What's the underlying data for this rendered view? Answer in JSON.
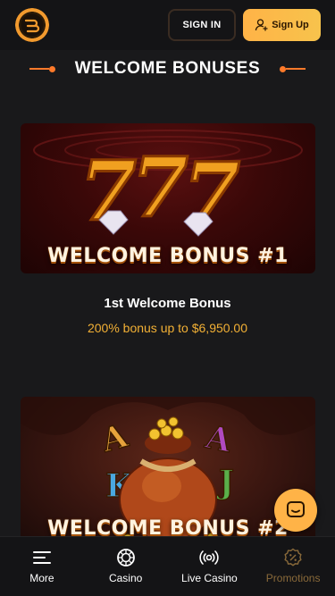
{
  "header": {
    "signin_label": "SIGN IN",
    "signup_label": "Sign Up"
  },
  "section": {
    "title": "WELCOME BONUSES"
  },
  "bonuses": [
    {
      "banner_text": "WELCOME BONUS #1",
      "title": "1st Welcome Bonus",
      "offer": "200% bonus up to $6,950.00"
    },
    {
      "banner_text": "WELCOME BONUS #2"
    }
  ],
  "nav": {
    "items": [
      {
        "label": "More",
        "icon": "menu-icon"
      },
      {
        "label": "Casino",
        "icon": "casino-chip-icon"
      },
      {
        "label": "Live Casino",
        "icon": "broadcast-icon"
      },
      {
        "label": "Promotions",
        "icon": "percent-badge-icon"
      }
    ]
  },
  "colors": {
    "accent": "#ff7a2a",
    "gold": "#f2b035",
    "signup_bg": "#ffb347"
  }
}
